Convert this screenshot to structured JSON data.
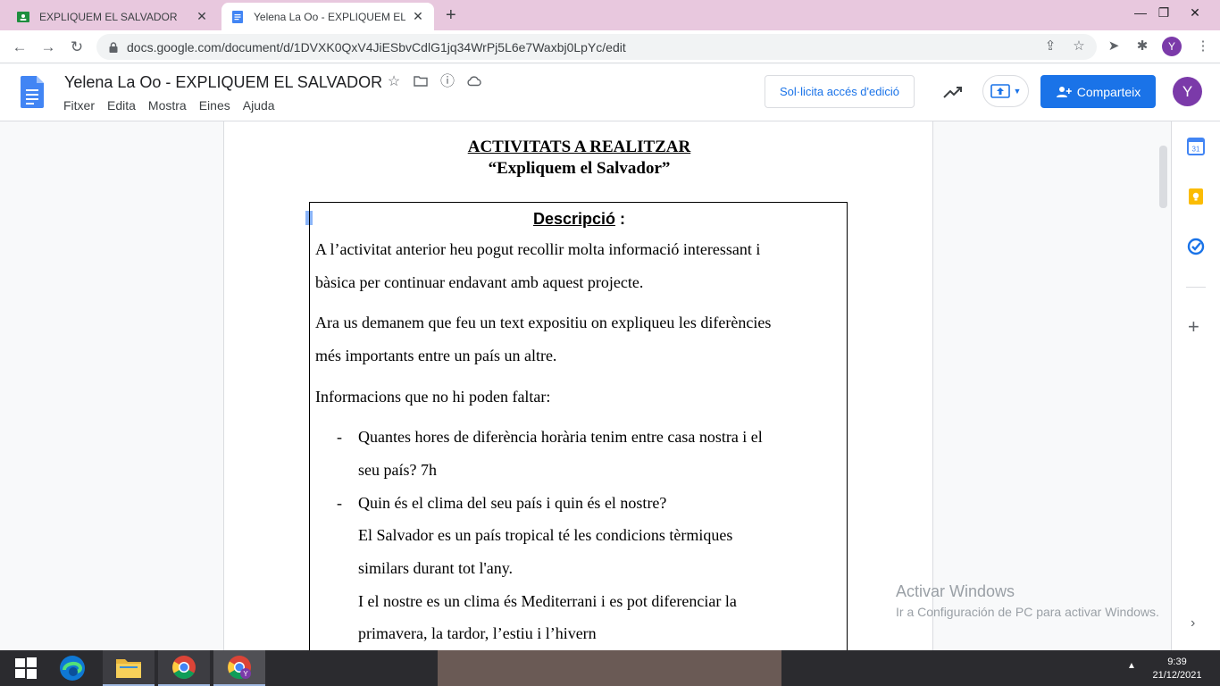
{
  "browser": {
    "tabs": [
      {
        "title": "EXPLIQUEM EL SALVADOR",
        "active": false
      },
      {
        "title": "Yelena La Oo - EXPLIQUEM EL SALVADOR",
        "active": true
      }
    ],
    "new_tab": "+",
    "url": "docs.google.com/document/d/1DVXK0QxV4JiESbvCdlG1jq34WrPj5L6e7Waxbj0LpYc/edit",
    "profile_initial": "Y",
    "window_controls": {
      "minimize": "—",
      "restore": "❐",
      "close": "✕"
    }
  },
  "docs": {
    "title": "Yelena La Oo - EXPLIQUEM EL SALVADOR",
    "menu": [
      "Fitxer",
      "Edita",
      "Mostra",
      "Eines",
      "Ajuda"
    ],
    "request_access_label": "Sol·licita accés d'edició",
    "share_label": "Comparteix",
    "avatar_initial": "Y"
  },
  "document": {
    "heading": "ACTIVITATS A REALITZAR",
    "subheading": "“Expliquem el Salvador”",
    "box_title": "Descripció",
    "box_title_suffix": " :",
    "para1_line1": "A l’activitat anterior heu pogut recollir molta informació interessant i",
    "para1_line2": "bàsica per continuar endavant amb aquest projecte.",
    "para2_line1": "Ara us demanem que feu un text expositiu on expliqueu les diferències",
    "para2_line2": "més importants entre un país un altre.",
    "para3": "Informacions que no hi poden faltar:",
    "bullet_char": "-",
    "item1_line1": "Quantes hores de diferència horària tenim entre casa nostra i el",
    "item1_line2": "seu país? 7h",
    "item2_line1": "Quin és el clima del seu país i quin és el nostre?",
    "item2_line2": "El Salvador es un país tropical  té les condicions tèrmiques",
    "item2_line3": "similars durant tot l'any.",
    "item2_line4": "I el nostre es un clima és Mediterrani i es pot diferenciar la",
    "item2_line5": "primavera, la tardor, l’estiu i l’hivern"
  },
  "watermark": {
    "line1": "Activar Windows",
    "line2": "Ir a Configuración de PC para activar Windows."
  },
  "side_panel": {
    "calendar_day": "31",
    "add": "+",
    "expand": "›"
  },
  "taskbar": {
    "time": "9:39",
    "date": "21/12/2021"
  }
}
